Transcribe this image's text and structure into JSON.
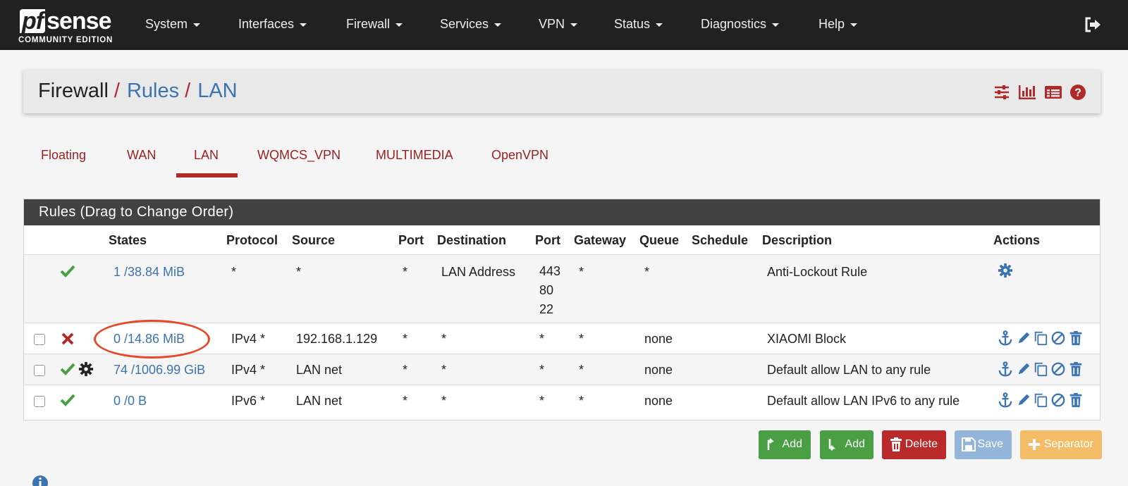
{
  "brand": {
    "name": "sense",
    "prefix": "pf",
    "edition": "COMMUNITY EDITION"
  },
  "nav": {
    "items": [
      {
        "label": "System"
      },
      {
        "label": "Interfaces"
      },
      {
        "label": "Firewall"
      },
      {
        "label": "Services"
      },
      {
        "label": "VPN"
      },
      {
        "label": "Status"
      },
      {
        "label": "Diagnostics"
      },
      {
        "label": "Help"
      }
    ],
    "logout_icon": "sign-out-icon"
  },
  "breadcrumb": {
    "root": "Firewall",
    "separator": "/",
    "level1": "Rules",
    "level2": "LAN",
    "icons": [
      "sliders-icon",
      "bar-chart-icon",
      "table-list-icon",
      "help-circle-icon"
    ]
  },
  "tabs": {
    "items": [
      {
        "label": "Floating"
      },
      {
        "label": "WAN"
      },
      {
        "label": "LAN"
      },
      {
        "label": "WQMCS_VPN"
      },
      {
        "label": "MULTIMEDIA"
      },
      {
        "label": "OpenVPN"
      }
    ],
    "active": "LAN"
  },
  "rules": {
    "heading": "Rules (Drag to Change Order)",
    "columns": {
      "states": "States",
      "protocol": "Protocol",
      "source": "Source",
      "port": "Port",
      "destination": "Destination",
      "dport": "Port",
      "gateway": "Gateway",
      "queue": "Queue",
      "schedule": "Schedule",
      "description": "Description",
      "actions": "Actions"
    },
    "rows": [
      {
        "status": "pass",
        "states": "1 /38.84 MiB",
        "protocol": "*",
        "source": "*",
        "port": "*",
        "destination": "LAN Address",
        "dport": "443\n80\n22",
        "gateway": "*",
        "queue": "*",
        "schedule": "",
        "description": "Anti-Lockout Rule"
      },
      {
        "status": "block",
        "states": "0 /14.86 MiB",
        "protocol": "IPv4 *",
        "source": "192.168.1.129",
        "port": "*",
        "destination": "*",
        "dport": "*",
        "gateway": "*",
        "queue": "none",
        "schedule": "",
        "description": "XIAOMI Block"
      },
      {
        "status": "pass",
        "states": "74 /1006.99 GiB",
        "protocol": "IPv4 *",
        "source": "LAN net",
        "port": "*",
        "destination": "*",
        "dport": "*",
        "gateway": "*",
        "queue": "none",
        "schedule": "",
        "description": "Default allow LAN to any rule"
      },
      {
        "status": "pass",
        "states": "0 /0 B",
        "protocol": "IPv6 *",
        "source": "LAN net",
        "port": "*",
        "destination": "*",
        "dport": "*",
        "gateway": "*",
        "queue": "none",
        "schedule": "",
        "description": "Default allow LAN IPv6 to any rule"
      }
    ]
  },
  "buttons": {
    "add_top": "Add",
    "add_bottom": "Add",
    "delete": "Delete",
    "save": "Save",
    "separator": "Separator"
  },
  "colors": {
    "navbar": "#212121",
    "accent_red": "#b12a2a",
    "link_blue": "#3b74b0",
    "pass_green": "#4a9e44",
    "highlight": "#e24a2a"
  }
}
